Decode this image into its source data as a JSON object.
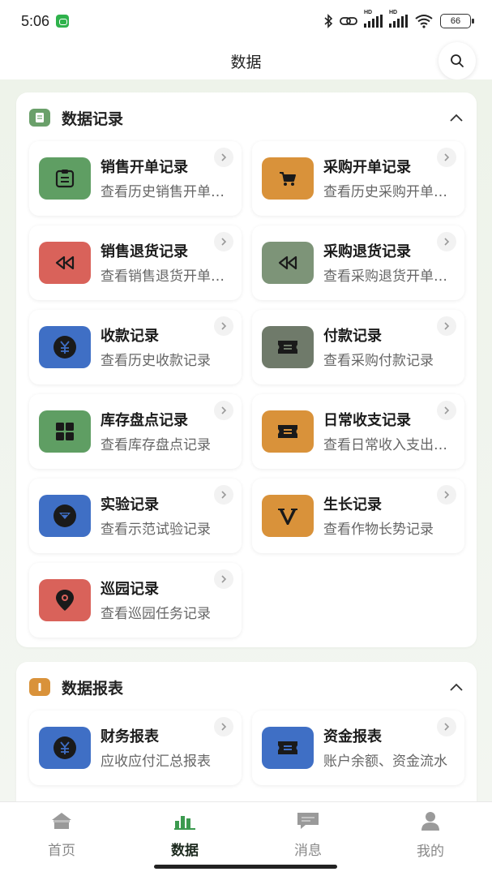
{
  "status": {
    "time": "5:06",
    "battery": "66",
    "hd1": "HD",
    "hd2": "HD"
  },
  "header": {
    "title": "数据"
  },
  "sections": [
    {
      "title": "数据记录",
      "icon_color": "#6aa06a",
      "cards": [
        {
          "title": "销售开单记录",
          "desc": "查看历史销售开单记录",
          "icon": "clipboard-icon",
          "color": "#5f9e63"
        },
        {
          "title": "采购开单记录",
          "desc": "查看历史采购开单记录",
          "icon": "cart-icon",
          "color": "#d9923a"
        },
        {
          "title": "销售退货记录",
          "desc": "查看销售退货开单记录",
          "icon": "rewind-icon",
          "color": "#d9625a"
        },
        {
          "title": "采购退货记录",
          "desc": "查看采购退货开单记录",
          "icon": "rewind-icon",
          "color": "#7d9478"
        },
        {
          "title": "收款记录",
          "desc": "查看历史收款记录",
          "icon": "yen-icon",
          "color": "#3f6fc5"
        },
        {
          "title": "付款记录",
          "desc": "查看采购付款记录",
          "icon": "ticket-icon",
          "color": "#6f7a6a"
        },
        {
          "title": "库存盘点记录",
          "desc": "查看库存盘点记录",
          "icon": "grid-icon",
          "color": "#5f9e63"
        },
        {
          "title": "日常收支记录",
          "desc": "查看日常收入支出记录",
          "icon": "ticket-icon",
          "color": "#d9923a"
        },
        {
          "title": "实验记录",
          "desc": "查看示范试验记录",
          "icon": "diamond-icon",
          "color": "#3f6fc5"
        },
        {
          "title": "生长记录",
          "desc": "查看作物长势记录",
          "icon": "v-icon",
          "color": "#d9923a"
        },
        {
          "title": "巡园记录",
          "desc": "查看巡园任务记录",
          "icon": "pin-icon",
          "color": "#d9625a"
        }
      ]
    },
    {
      "title": "数据报表",
      "icon_color": "#d9923a",
      "cards": [
        {
          "title": "财务报表",
          "desc": "应收应付汇总报表",
          "icon": "yen-icon",
          "color": "#3f6fc5"
        },
        {
          "title": "资金报表",
          "desc": "账户余额、资金流水",
          "icon": "ticket-icon",
          "color": "#3f6fc5"
        }
      ]
    }
  ],
  "tabs": [
    {
      "label": "首页",
      "icon": "home-icon"
    },
    {
      "label": "数据",
      "icon": "bar-chart-icon",
      "active": true
    },
    {
      "label": "消息",
      "icon": "message-icon"
    },
    {
      "label": "我的",
      "icon": "person-icon"
    }
  ]
}
